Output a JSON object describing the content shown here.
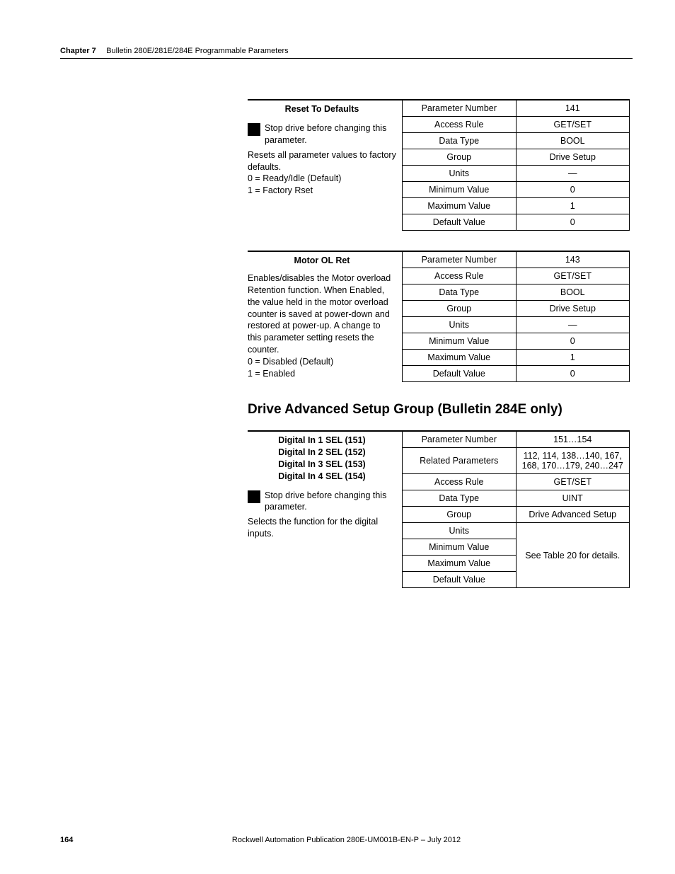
{
  "header": {
    "chapter": "Chapter 7",
    "title": "Bulletin 280E/281E/284E Programmable Parameters"
  },
  "block1": {
    "title": "Reset To Defaults",
    "warn": "Stop drive before changing this parameter.",
    "desc": "Resets all parameter values to factory defaults.",
    "opt0": "0 = Ready/Idle (Default)",
    "opt1": "1 = Factory Rset",
    "rows": {
      "pn_l": "Parameter Number",
      "pn_v": "141",
      "ar_l": "Access Rule",
      "ar_v": "GET/SET",
      "dt_l": "Data Type",
      "dt_v": "BOOL",
      "gr_l": "Group",
      "gr_v": "Drive Setup",
      "un_l": "Units",
      "un_v": "—",
      "mn_l": "Minimum Value",
      "mn_v": "0",
      "mx_l": "Maximum Value",
      "mx_v": "1",
      "df_l": "Default Value",
      "df_v": "0"
    }
  },
  "block2": {
    "title": "Motor OL Ret",
    "desc": "Enables/disables the Motor overload Retention function. When Enabled, the value held in the motor overload counter is saved at power-down and restored at power-up. A change to this parameter setting resets the counter.",
    "opt0": "0 = Disabled (Default)",
    "opt1": "1 = Enabled",
    "rows": {
      "pn_l": "Parameter Number",
      "pn_v": "143",
      "ar_l": "Access Rule",
      "ar_v": "GET/SET",
      "dt_l": "Data Type",
      "dt_v": "BOOL",
      "gr_l": "Group",
      "gr_v": "Drive Setup",
      "un_l": "Units",
      "un_v": "—",
      "mn_l": "Minimum Value",
      "mn_v": "0",
      "mx_l": "Maximum Value",
      "mx_v": "1",
      "df_l": "Default Value",
      "df_v": "0"
    }
  },
  "section": "Drive Advanced Setup Group (Bulletin 284E only)",
  "block3": {
    "t1": "Digital In 1 SEL (151)",
    "t2": "Digital In 2 SEL (152)",
    "t3": "Digital In 3 SEL (153)",
    "t4": "Digital In 4 SEL (154)",
    "warn": "Stop drive before changing this parameter.",
    "desc": "Selects the function for the digital inputs.",
    "rows": {
      "pn_l": "Parameter Number",
      "pn_v": "151…154",
      "rp_l": "Related Parameters",
      "rp_v": "112, 114, 138…140, 167, 168, 170…179, 240…247",
      "ar_l": "Access Rule",
      "ar_v": "GET/SET",
      "dt_l": "Data Type",
      "dt_v": "UINT",
      "gr_l": "Group",
      "gr_v": "Drive Advanced Setup",
      "un_l": "Units",
      "mn_l": "Minimum Value",
      "mx_l": "Maximum Value",
      "df_l": "Default Value",
      "merged": "See Table 20 for details."
    }
  },
  "footer": {
    "page": "164",
    "pub": "Rockwell Automation Publication 280E-UM001B-EN-P – July 2012"
  }
}
